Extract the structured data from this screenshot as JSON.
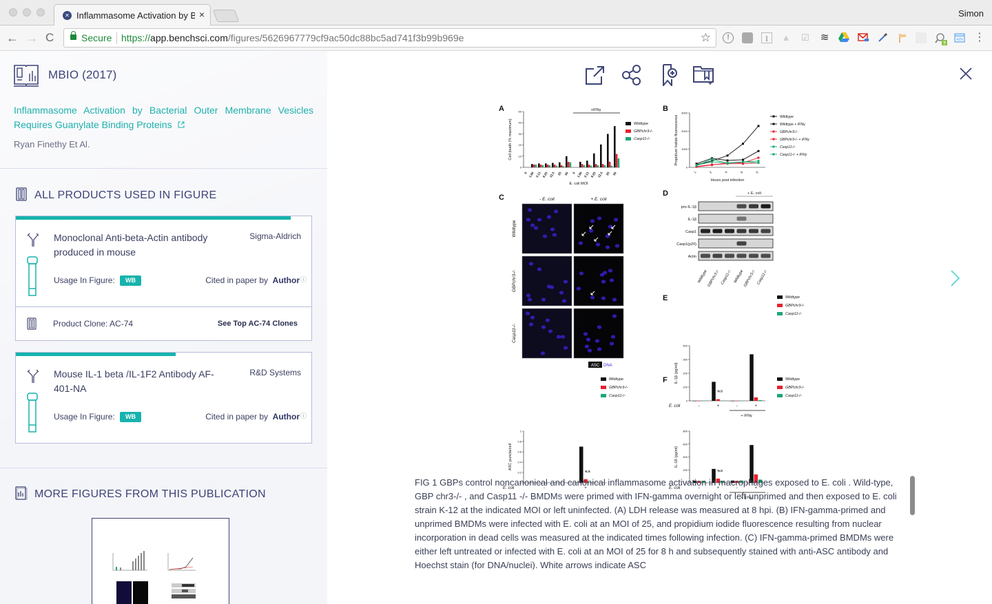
{
  "browser": {
    "tab_title": "Inflammasome Activation by Ba",
    "tab_close": "×",
    "user_name": "Simon",
    "secure_label": "Secure",
    "url_scheme": "https://",
    "url_host": "app.benchsci.com",
    "url_path": "/figures/5626967779cf9ac50dc88bc5ad741f3b99b969e",
    "back_icon": "←",
    "forward_icon": "→",
    "reload_icon": "C",
    "bookmark_icon": "☆",
    "menu_icon": "⋮",
    "extensions": [
      "info-extension",
      "evernote-extension",
      "instapaper-extension",
      "drive-grey-extension",
      "checkbox-extension",
      "buffer-extension",
      "google-drive-extension",
      "gmail-extension",
      "eyedropper-extension",
      "signpost-extension",
      "dragon-extension",
      "search-help-extension",
      "devtools-extension"
    ]
  },
  "sidebar": {
    "journal": "MBIO (2017)",
    "paper_title": "Inflammasome Activation by Bacterial Outer Membrane Vesicles Requires Guanylate Binding Proteins",
    "external_link_icon": "↗",
    "authors": "Ryan Finethy Et Al.",
    "products_heading": "ALL PRODUCTS USED IN FIGURE",
    "products": [
      {
        "name": "Monoclonal Anti-beta-Actin antibody produced in mouse",
        "vendor": "Sigma-Aldrich",
        "usage_label": "Usage In Figure:",
        "usage_badge": "WB",
        "cited_prefix": "Cited in paper by",
        "cited_by": "Author",
        "help_icon": "?",
        "relevance": 0.93,
        "clone_label": "Product Clone: AC-74",
        "clone_link": "See Top AC-74 Clones"
      },
      {
        "name": "Mouse IL-1 beta /IL-1F2 Antibody AF-401-NA",
        "vendor": "R&D Systems",
        "usage_label": "Usage In Figure:",
        "usage_badge": "WB",
        "cited_prefix": "Cited in paper by",
        "cited_by": "Author",
        "help_icon": "?",
        "relevance": 0.54
      }
    ],
    "more_heading": "MORE FIGURES FROM THIS PUBLICATION"
  },
  "viewer": {
    "toolbar": [
      "open-external",
      "share",
      "bookmark-add",
      "save-to-folder"
    ],
    "caption": "FIG 1 GBPs control noncanonical and canonical inflammasome activation in macrophages exposed to E. coli . Wild-type, GBP chr3-/- , and Casp11 -/- BMDMs were primed with IFN-gamma overnight or left unprimed and then exposed to E. coli strain K-12 at the indicated MOI or left uninfected. (A) LDH release was measured at 8 hpi. (B) IFN-gamma-primed and unprimed BMDMs were infected with E. coli at an MOI of 25, and propidium iodide fluorescence resulting from nuclear incorporation in dead cells was measured at the indicated times following infection. (C) IFN-gamma-primed BMDMs were either left untreated or infected with E. coli at an MOI of 25 for 8 h and subsequently stained with anti-ASC antibody and Hoechst stain (for DNA/nuclei). White arrows indicate ASC"
  },
  "colors": {
    "accent": "#17b3ad",
    "navy": "#3d4476",
    "wildtype": "#111111",
    "gbp": "#e8212e",
    "casp11": "#19a974"
  },
  "chart_data": [
    {
      "panel": "A",
      "type": "bar",
      "title": "+IFNγ",
      "ylabel": "Cell death (% maximum)",
      "xlabel": "E. coli MOI",
      "ylim": [
        0,
        50
      ],
      "yticks": [
        0,
        10,
        20,
        30,
        40,
        50
      ],
      "categories": [
        "0",
        "1.56",
        "3.13",
        "6.25",
        "12.5",
        "25",
        "50",
        "0",
        "1.56",
        "3.13",
        "6.25",
        "12.5",
        "25",
        "50"
      ],
      "legend": [
        "Wildtype",
        "GBPchr3-/-",
        "Casp11-/-"
      ],
      "series": [
        {
          "name": "Wildtype",
          "values": [
            0,
            3,
            3.5,
            3.5,
            4,
            4.5,
            10,
            0,
            5,
            6,
            12.5,
            20.5,
            30,
            37
          ]
        },
        {
          "name": "GBPchr3-/-",
          "values": [
            0,
            2.5,
            2.5,
            2.5,
            2.5,
            2,
            5,
            0,
            3,
            2.5,
            3,
            3,
            5,
            12
          ]
        },
        {
          "name": "Casp11-/-",
          "values": [
            0,
            2.5,
            2,
            2,
            1.5,
            1,
            4.5,
            0,
            2,
            1.5,
            2,
            2,
            1.5,
            8
          ]
        }
      ]
    },
    {
      "panel": "B",
      "type": "line",
      "ylabel": "Propidium Iodide fluorescence (Relative uninfected)",
      "xlabel": "Hours post infection",
      "x": [
        1,
        2,
        4,
        6,
        8
      ],
      "ylim": [
        0,
        3000
      ],
      "yticks": [
        0,
        1000,
        2000,
        3000
      ],
      "series": [
        {
          "name": "Wildtype",
          "values": [
            200,
            500,
            380,
            420,
            900
          ]
        },
        {
          "name": "Wildtype + IFNγ",
          "values": [
            150,
            350,
            650,
            1300,
            2280
          ]
        },
        {
          "name": "GBPchr3-/-",
          "values": [
            50,
            150,
            200,
            200,
            250
          ]
        },
        {
          "name": "GBPchr3-/- + IFNγ",
          "values": [
            30,
            130,
            250,
            250,
            530
          ]
        },
        {
          "name": "Casp11-/-",
          "values": [
            120,
            300,
            250,
            300,
            250
          ]
        },
        {
          "name": "Casp11-/- + IFNγ",
          "values": [
            100,
            450,
            220,
            300,
            350
          ]
        }
      ]
    },
    {
      "panel": "C",
      "type": "image-grid",
      "column_labels": [
        "- E. coli",
        "+ E. coli"
      ],
      "row_labels": [
        "Wildtype",
        "GBPchr3-/-",
        "Casp11-/-"
      ],
      "stain_legend": [
        "ASC",
        "DNA"
      ]
    },
    {
      "panel": "D",
      "type": "blot",
      "header": "+ E. coli",
      "rows": [
        "pro-IL-1β",
        "IL-1β",
        "Casp1",
        "Casp1(p20)",
        "Actin"
      ],
      "lanes": [
        "Wildtype",
        "GBPchr3-/-",
        "Casp11-/-",
        "Wildtype",
        "GBPchr3-/-",
        "Casp11-/-"
      ]
    },
    {
      "panel": "E",
      "type": "bar",
      "ylabel": "IL-1β (pg/ml)",
      "ylim": [
        0,
        400
      ],
      "yticks": [
        0,
        100,
        200,
        300,
        400
      ],
      "categories": [
        "-",
        "+",
        "-",
        "+"
      ],
      "x_row_label": "E. coli",
      "group_label": "+ IFNγ",
      "legend": [
        "Wildtype",
        "GBPchr3-/-",
        "Casp11-/-"
      ],
      "series": [
        {
          "name": "Wildtype",
          "values": [
            0,
            138,
            0,
            338
          ]
        },
        {
          "name": "GBPchr3-/-",
          "values": [
            0,
            12,
            0,
            25
          ]
        },
        {
          "name": "Casp11-/-",
          "values": [
            0,
            2,
            0,
            5
          ]
        }
      ],
      "annotations": [
        "N.S",
        "***",
        "***",
        "*",
        "***",
        "***"
      ]
    },
    {
      "panel": "ASC",
      "type": "bar",
      "ylabel": "ASC puncta/cell",
      "ylim": [
        0,
        1.0
      ],
      "yticks": [
        0.0,
        0.2,
        0.4,
        0.6,
        0.8,
        1.0
      ],
      "categories": [
        "-",
        "+"
      ],
      "x_row_label": "E. coli",
      "legend": [
        "Wildtype",
        "GBPchr3-/-",
        "Casp11-/-"
      ],
      "series": [
        {
          "name": "Wildtype",
          "values": [
            0,
            0.7
          ]
        },
        {
          "name": "GBPchr3-/-",
          "values": [
            0,
            0.07
          ]
        },
        {
          "name": "Casp11-/-",
          "values": [
            0,
            0.01
          ]
        }
      ],
      "annotations": [
        "N.S",
        "***",
        "***"
      ]
    },
    {
      "panel": "F",
      "type": "bar",
      "ylabel": "IL-18 (pg/ml)",
      "ylim": [
        0,
        800
      ],
      "yticks": [
        0,
        200,
        400,
        600,
        800
      ],
      "categories": [
        "-",
        "+",
        "-",
        "+"
      ],
      "x_row_label": "E. coli",
      "group_label": "+ IFNγ",
      "legend": [
        "Wildtype",
        "GBPchr3-/-",
        "Casp11-/-"
      ],
      "series": [
        {
          "name": "Wildtype",
          "values": [
            35,
            215,
            35,
            585
          ]
        },
        {
          "name": "GBPchr3-/-",
          "values": [
            28,
            65,
            30,
            130
          ]
        },
        {
          "name": "Casp11-/-",
          "values": [
            30,
            30,
            35,
            50
          ]
        }
      ],
      "annotations": [
        "N.S",
        "***",
        "***",
        "***",
        "***",
        "***"
      ]
    }
  ]
}
